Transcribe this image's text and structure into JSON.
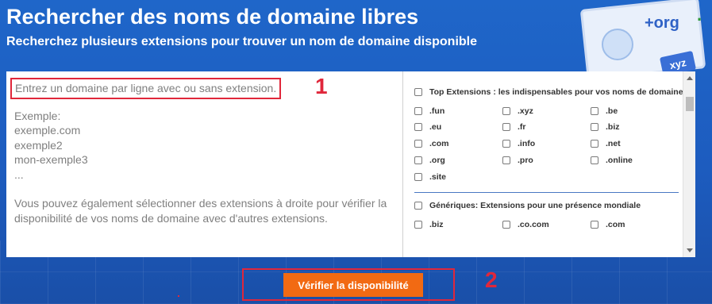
{
  "header": {
    "title": "Rechercher des noms de domaine libres",
    "subtitle": "Recherchez plusieurs extensions pour trouver un nom de domaine disponible"
  },
  "background": {
    "org_text": "+org",
    "xyz_badge": "xyz",
    "dot_text": "."
  },
  "textarea": {
    "lines": {
      "first": "Entrez un domaine par ligne avec ou sans extension.",
      "example_label": "Exemple:",
      "ex1": "exemple.com",
      "ex2": "exemple2",
      "ex3": "mon-exemple3",
      "ellipsis": "...",
      "hint1": "Vous pouvez également sélectionner des extensions à droite pour vérifier la",
      "hint2": "disponibilité de vos noms de domaine avec d'autres extensions."
    }
  },
  "extensions": {
    "top_group_label": "Top Extensions : les indispensables pour vos noms de domaine",
    "top_items": [
      ".fun",
      ".xyz",
      ".be",
      ".eu",
      ".fr",
      ".biz",
      ".com",
      ".info",
      ".net",
      ".org",
      ".pro",
      ".online",
      ".site"
    ],
    "generic_group_label": "Génériques: Extensions pour une présence mondiale",
    "generic_items": [
      ".biz",
      ".co.com",
      ".com"
    ]
  },
  "button": {
    "label": "Vérifier la disponibilité"
  },
  "annotations": {
    "one": "1",
    "two": "2"
  },
  "colors": {
    "background_blue": "#1f66c9",
    "button_orange": "#f26a13",
    "annotation_red": "#e0273b"
  }
}
